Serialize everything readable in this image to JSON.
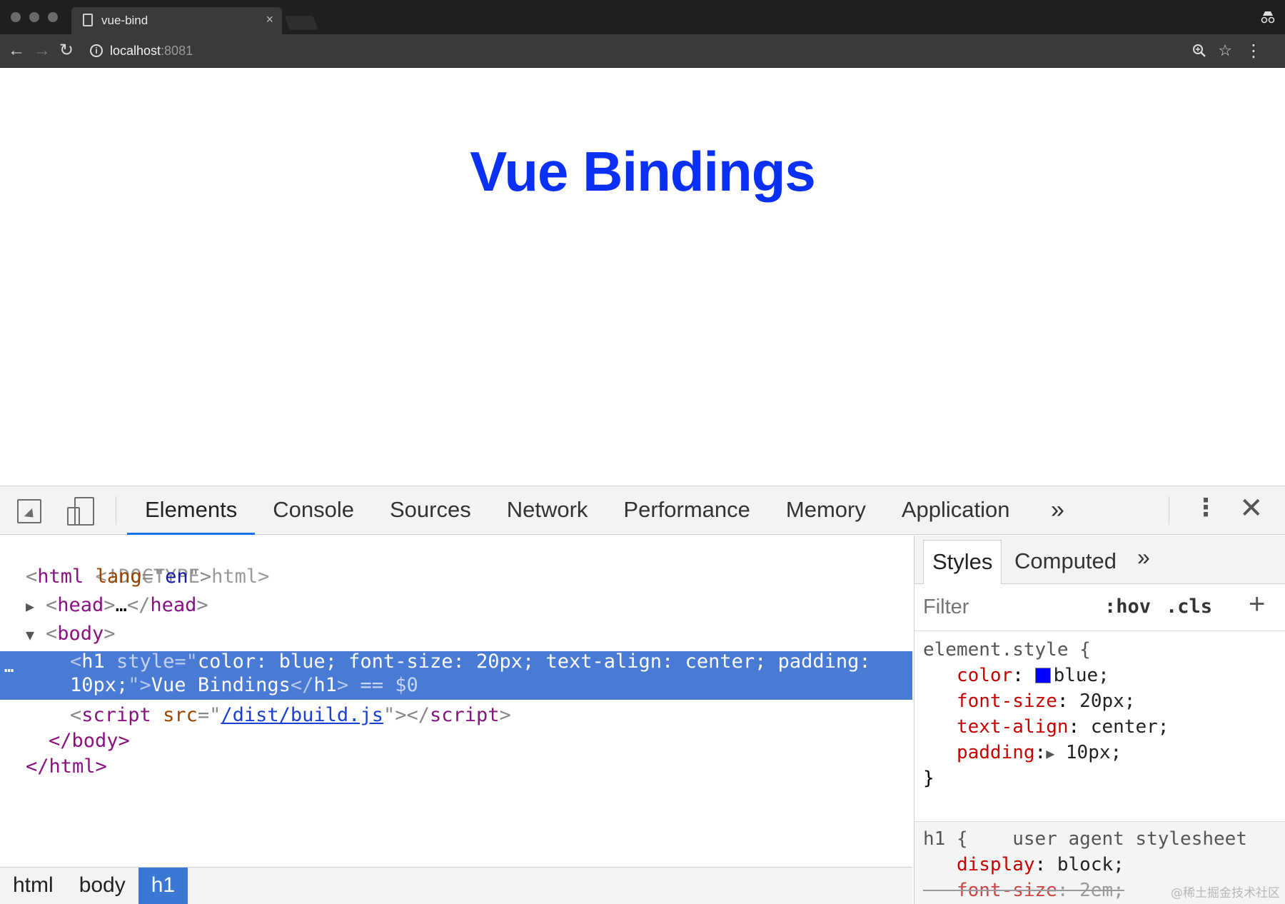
{
  "browser": {
    "tab_title": "vue-bind",
    "tab_close": "×",
    "url_host": "localhost",
    "url_port": ":8081"
  },
  "page": {
    "heading": "Vue Bindings"
  },
  "devtools": {
    "tabs": [
      "Elements",
      "Console",
      "Sources",
      "Network",
      "Performance",
      "Memory",
      "Application"
    ],
    "more_tabs": "»",
    "dom": {
      "doctype": "<!DOCTYPE html>",
      "html_open": {
        "tag": "html",
        "attr": "lang",
        "value": "en"
      },
      "head": {
        "tag": "head",
        "ellipsis": "…"
      },
      "body": {
        "tag": "body"
      },
      "h1": {
        "tag": "h1",
        "attr": "style",
        "value_line1": "color: blue; font-size: 20px; text-align: center; padding:",
        "value_line2": "10px;",
        "text": "Vue Bindings",
        "equals": "== $0"
      },
      "script": {
        "tag": "script",
        "attr": "src",
        "value": "/dist/build.js"
      },
      "body_close": "</body>",
      "html_close": "</html>"
    },
    "breadcrumbs": [
      "html",
      "body",
      "h1"
    ],
    "styles": {
      "tabs": [
        "Styles",
        "Computed"
      ],
      "more": "»",
      "filter_placeholder": "Filter",
      "hov": ":hov",
      "cls": ".cls",
      "plus": "+",
      "element_style": {
        "selector": "element.style {",
        "props": [
          {
            "name": "color",
            "value": "blue;",
            "swatch": "#0000ff"
          },
          {
            "name": "font-size",
            "value": "20px;"
          },
          {
            "name": "text-align",
            "value": "center;"
          },
          {
            "name": "padding",
            "value": "10px;",
            "expandable": true
          }
        ],
        "close": "}"
      },
      "ua_rule": {
        "selector": "h1 {",
        "source": "user agent stylesheet",
        "props": [
          {
            "name": "display",
            "value": "block;"
          },
          {
            "name": "font-size",
            "value": "2em;",
            "overridden": true
          }
        ]
      }
    },
    "watermark": "@稀土掘金技术社区"
  }
}
